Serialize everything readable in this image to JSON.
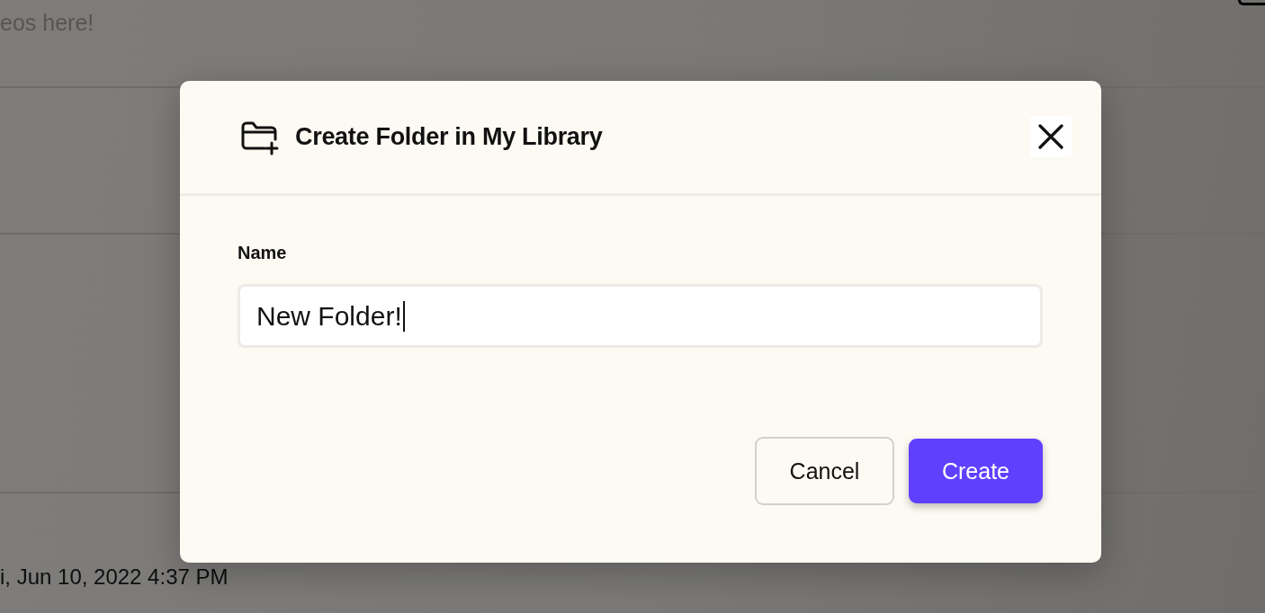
{
  "page": {
    "header_text": "eos here!",
    "timestamp": "i, Jun 10, 2022 4:37 PM"
  },
  "dialog": {
    "title": "Create Folder in My Library",
    "field": {
      "label": "Name",
      "value": "New Folder!",
      "focused": true
    },
    "buttons": [
      {
        "label": "Cancel",
        "kind": "secondary"
      },
      {
        "label": "Create",
        "kind": "primary"
      }
    ]
  }
}
